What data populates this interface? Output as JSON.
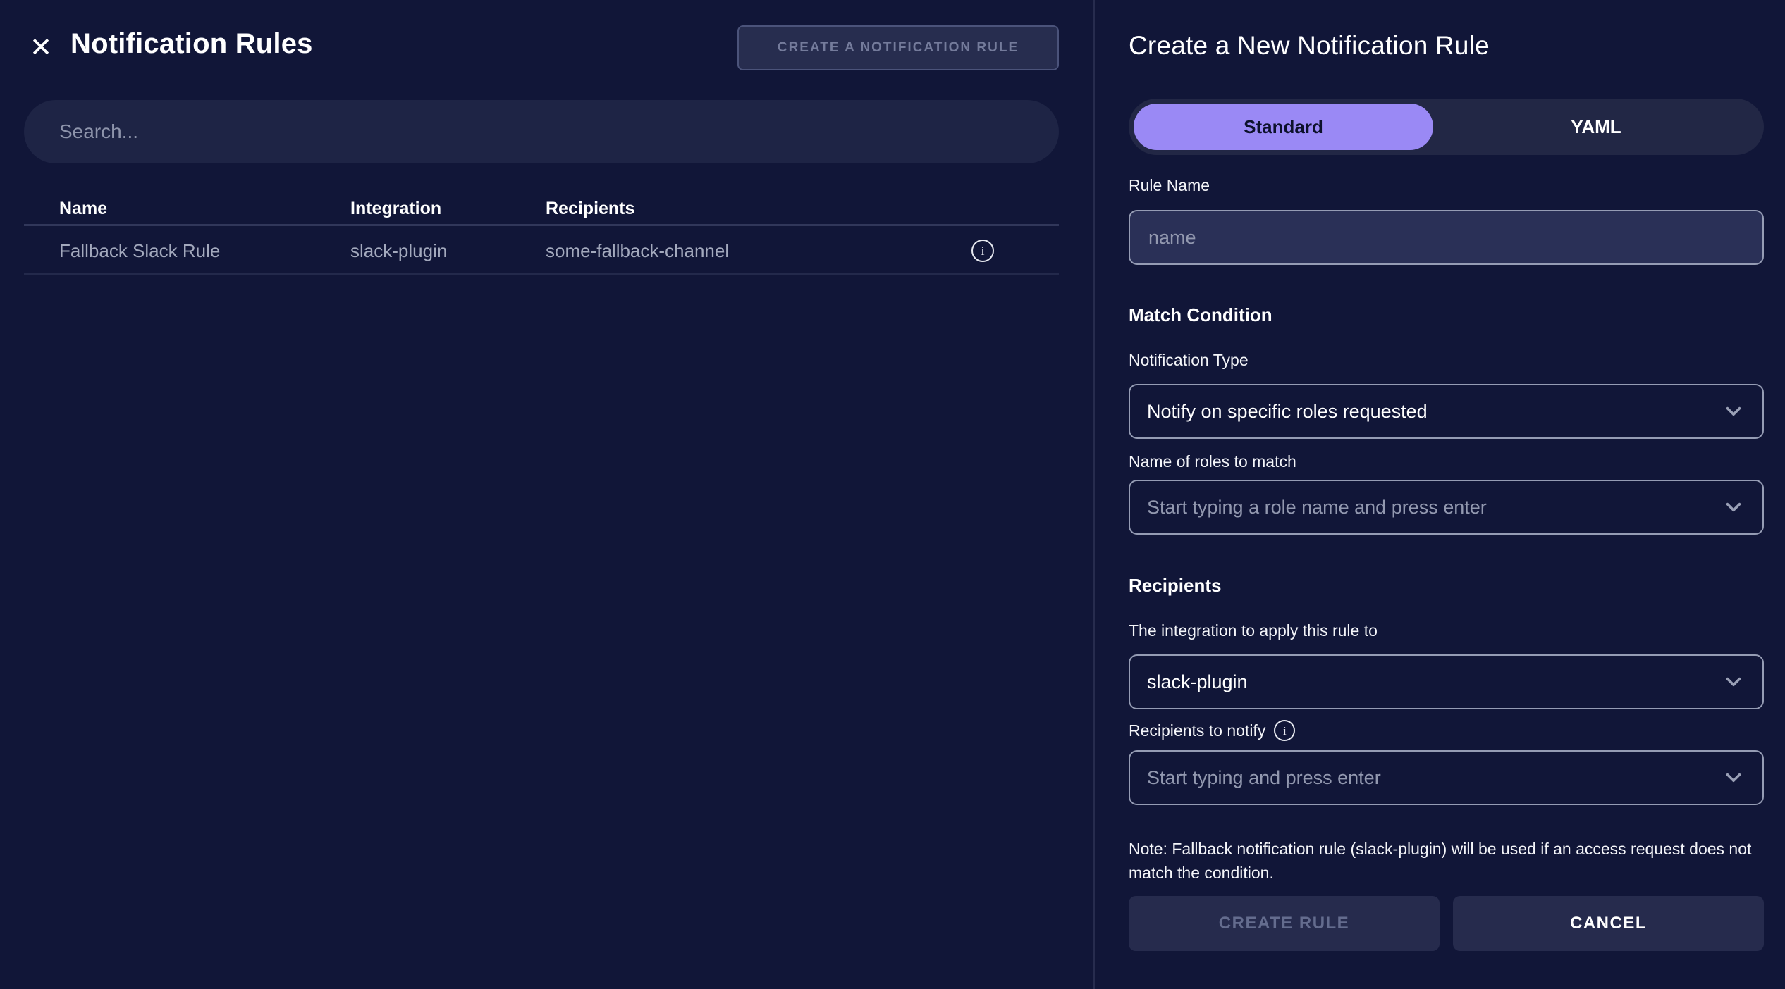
{
  "left_panel": {
    "title": "Notification Rules",
    "close_icon": "✕",
    "create_button_label": "CREATE A NOTIFICATION RULE",
    "search_placeholder": "Search...",
    "table": {
      "columns": [
        "Name",
        "Integration",
        "Recipients"
      ],
      "rows": [
        {
          "name": "Fallback Slack Rule",
          "integration": "slack-plugin",
          "recipients": "some-fallback-channel"
        }
      ]
    }
  },
  "right_panel": {
    "title": "Create a New Notification Rule",
    "tabs": [
      {
        "label": "Standard",
        "active": true
      },
      {
        "label": "YAML",
        "active": false
      }
    ],
    "rule_name": {
      "label": "Rule Name",
      "placeholder": "name",
      "value": ""
    },
    "match_condition": {
      "heading": "Match Condition",
      "notification_type": {
        "label": "Notification Type",
        "selected_value": "Notify on specific roles requested"
      },
      "roles": {
        "label": "Name of roles to match",
        "placeholder": "Start typing a role name and press enter"
      }
    },
    "recipients": {
      "heading": "Recipients",
      "integration": {
        "label": "The integration to apply this rule to",
        "selected_value": "slack-plugin"
      },
      "notify": {
        "label": "Recipients to notify",
        "placeholder": "Start typing and press enter"
      }
    },
    "note": "Note: Fallback notification rule (slack-plugin) will be used if an access request does not match the condition.",
    "create_button_label": "CREATE RULE",
    "cancel_button_label": "CANCEL"
  },
  "icons": {
    "close": "close-icon",
    "info": "info-icon",
    "chevron": "chevron-down-icon"
  },
  "colors": {
    "background": "#111638",
    "panel_divider": "#272c4e",
    "accent_purple": "#9a89f5",
    "input_background": "#2a3057",
    "input_border": "#959cb4",
    "muted_text": "#9298af",
    "disabled_text": "#646c8e",
    "button_background": "#262b4d"
  }
}
